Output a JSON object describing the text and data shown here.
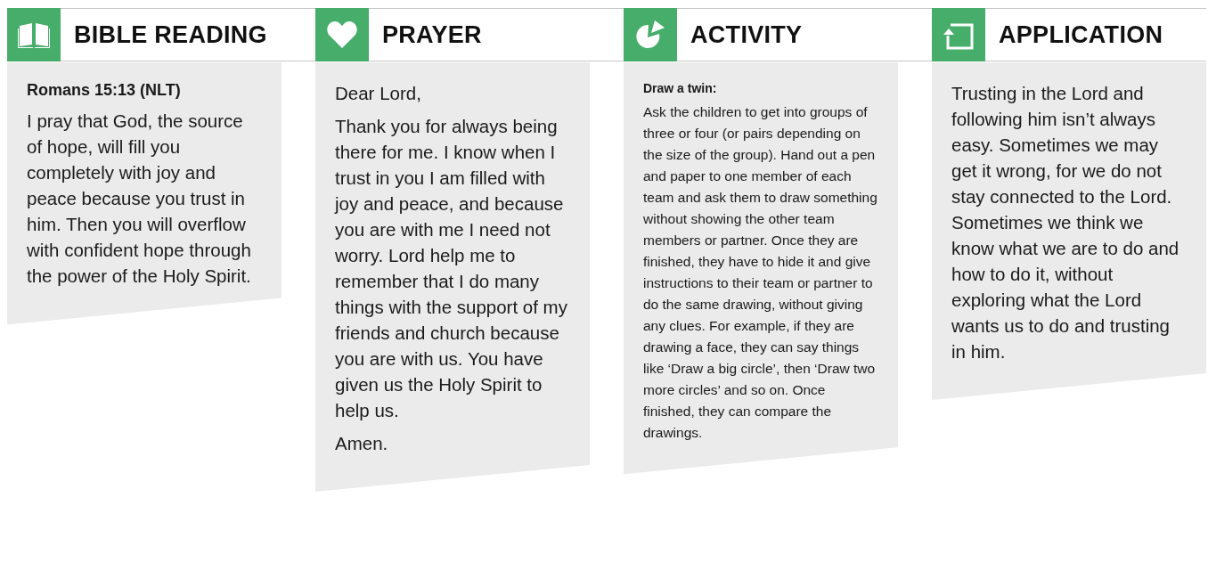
{
  "sections": [
    {
      "title": "BIBLE READING",
      "kind": "reading",
      "blocks": [
        {
          "kind": "heading",
          "text": "Romans 15:13 (NLT)"
        },
        {
          "kind": "paragraph",
          "text": "I pray that God, the source of hope, will fill you completely with joy and peace because you trust in him. Then you will overflow with confident hope through the power of the Holy Spirit."
        }
      ]
    },
    {
      "title": "PRAYER",
      "kind": "prayer",
      "blocks": [
        {
          "kind": "paragraph",
          "text": "Dear Lord,"
        },
        {
          "kind": "paragraph",
          "text": "Thank you for always being there for me. I know when I trust in you I am filled with joy and peace, and because you are with me I need not worry. Lord help me to remember that I do many things with the support of my friends and church because you are with us. You have given us the Holy Spirit to help us."
        },
        {
          "kind": "paragraph",
          "text": "Amen."
        }
      ]
    },
    {
      "title": "ACTIVITY",
      "kind": "activity",
      "blocks": [
        {
          "kind": "heading",
          "text": "Draw a twin:"
        },
        {
          "kind": "paragraph",
          "text": "Ask the children to get into groups of three or four (or pairs depending on the size of the group). Hand out a pen and paper to one member of each team and ask them to draw something without showing the other team members or partner. Once they are finished, they have to hide it and give instructions to their team or partner to do the same drawing, without giving any clues. For example, if they are drawing a face, they can say things like ‘Draw a big circle’, then ‘Draw two more circles’ and so on. Once finished, they can compare the drawings."
        }
      ]
    },
    {
      "title": "APPLICATION",
      "kind": "application",
      "blocks": [
        {
          "kind": "paragraph",
          "text": "Trusting in the Lord and following him isn’t always easy. Sometimes we may get it wrong, for we do not stay connected to the Lord. Sometimes we think we know what we are to do and how to do it, without exploring what the Lord wants us to do and trusting in him."
        }
      ]
    }
  ]
}
